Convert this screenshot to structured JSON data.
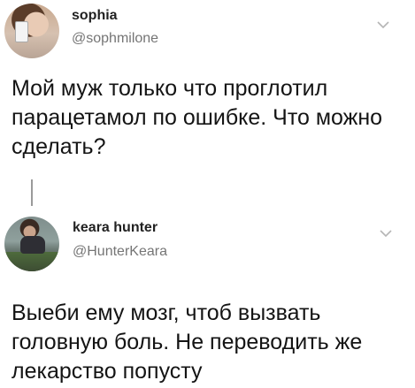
{
  "tweets": [
    {
      "display_name": "sophia",
      "handle": "@sophmilone",
      "text": "Мой муж только что проглотил парацетамол по ошибке. Что можно сделать?",
      "avatar_icon": "avatar-photo-icon",
      "menu_icon": "chevron-down-icon"
    },
    {
      "display_name": "keara hunter",
      "handle": "@HunterKeara",
      "text": "Выеби ему мозг, чтоб вызвать головную боль. Не переводить же лекарство попусту",
      "avatar_icon": "avatar-photo-icon",
      "menu_icon": "chevron-down-icon"
    }
  ],
  "colors": {
    "background": "#ffffff",
    "text": "#141414",
    "handle": "#757575",
    "thread_line": "#9a9a9a"
  }
}
